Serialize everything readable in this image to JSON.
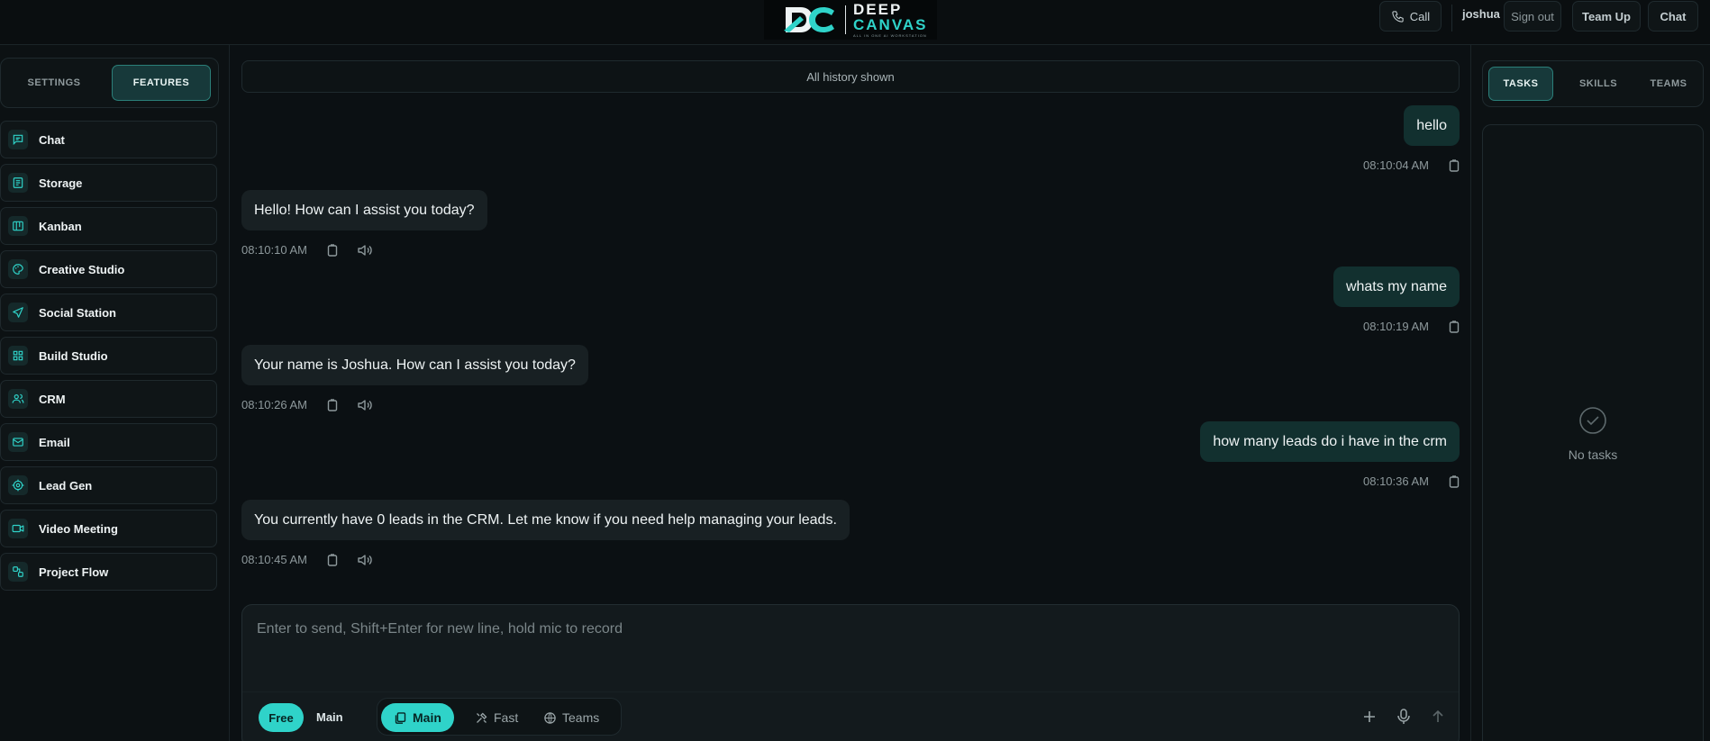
{
  "brand": {
    "name_line1": "DEEP",
    "name_line2": "CANVAS",
    "tagline": "ALL IN ONE AI WORKSTATION",
    "accent": "#2fd3c9"
  },
  "topbar": {
    "call_label": "Call",
    "username": "joshua",
    "signout_label": "Sign out",
    "teamup_label": "Team Up",
    "chat_label": "Chat"
  },
  "sidebar": {
    "tabs": [
      "SETTINGS",
      "FEATURES"
    ],
    "active_tab": "FEATURES",
    "items": [
      {
        "label": "Chat",
        "icon": "chat-icon"
      },
      {
        "label": "Storage",
        "icon": "storage-icon"
      },
      {
        "label": "Kanban",
        "icon": "kanban-icon"
      },
      {
        "label": "Creative Studio",
        "icon": "palette-icon"
      },
      {
        "label": "Social Station",
        "icon": "send-icon"
      },
      {
        "label": "Build Studio",
        "icon": "grid-icon"
      },
      {
        "label": "CRM",
        "icon": "users-icon"
      },
      {
        "label": "Email",
        "icon": "mail-icon"
      },
      {
        "label": "Lead Gen",
        "icon": "target-icon"
      },
      {
        "label": "Video Meeting",
        "icon": "video-icon"
      },
      {
        "label": "Project Flow",
        "icon": "flow-icon"
      }
    ]
  },
  "chat": {
    "history_label": "All history shown",
    "messages": [
      {
        "role": "user",
        "text": "hello",
        "time": "08:10:04 AM"
      },
      {
        "role": "assistant",
        "text": "Hello! How can I assist you today?",
        "time": "08:10:10 AM"
      },
      {
        "role": "user",
        "text": "whats my name",
        "time": "08:10:19 AM"
      },
      {
        "role": "assistant",
        "text": "Your name is Joshua. How can I assist you today?",
        "time": "08:10:26 AM"
      },
      {
        "role": "user",
        "text": "how many leads do i have in the crm",
        "time": "08:10:36 AM"
      },
      {
        "role": "assistant",
        "text": "You currently have 0 leads in the CRM. Let me know if you need help managing your leads.",
        "time": "08:10:45 AM"
      }
    ],
    "composer": {
      "placeholder": "Enter to send, Shift+Enter for new line, hold mic to record",
      "value": "",
      "plan_badge": "Free",
      "plan_name": "Main",
      "modes": [
        "Main",
        "Fast",
        "Teams"
      ],
      "active_mode": "Main"
    }
  },
  "rightpanel": {
    "tabs": [
      "TASKS",
      "SKILLS",
      "TEAMS"
    ],
    "active_tab": "TASKS",
    "empty_text": "No tasks"
  }
}
